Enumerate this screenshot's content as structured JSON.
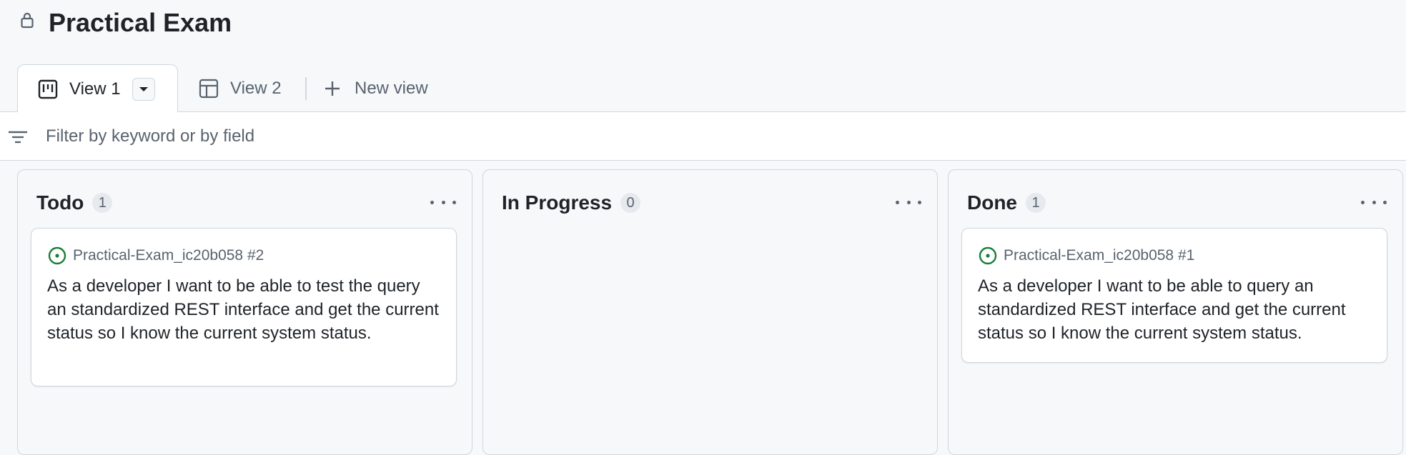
{
  "header": {
    "title": "Practical Exam",
    "lock_icon": "lock-icon"
  },
  "tabs": [
    {
      "label": "View 1",
      "icon": "board-icon",
      "active": true
    },
    {
      "label": "View 2",
      "icon": "table-icon",
      "active": false
    },
    {
      "label": "New view",
      "icon": "plus-icon",
      "active": false
    }
  ],
  "filter": {
    "placeholder": "Filter by keyword or by field",
    "value": "",
    "icon": "filter-icon"
  },
  "columns": [
    {
      "title": "Todo",
      "count": "1",
      "cards": [
        {
          "ref": "Practical-Exam_ic20b058 #2",
          "text": "As a developer I want to be able to test the query an standardized REST interface and get the current status so I know the current system status.",
          "status_icon": "open-issue-icon"
        }
      ]
    },
    {
      "title": "In Progress",
      "count": "0",
      "cards": []
    },
    {
      "title": "Done",
      "count": "1",
      "cards": [
        {
          "ref": "Practical-Exam_ic20b058 #1",
          "text": "As a developer I want to be able to query an standardized REST interface and get the current status so I know the current system status.",
          "status_icon": "open-issue-icon"
        }
      ]
    }
  ],
  "colors": {
    "issue_open": "#1a7f37",
    "text_primary": "#1f2328",
    "text_muted": "#59636e",
    "border": "#d0d7de"
  }
}
